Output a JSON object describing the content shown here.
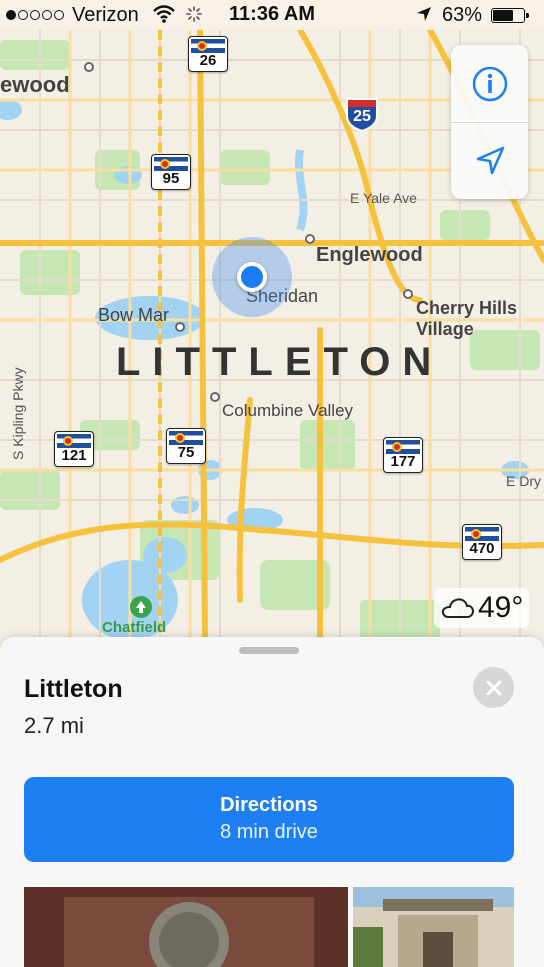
{
  "status_bar": {
    "carrier": "Verizon",
    "signal_bars": 1,
    "time": "11:36 AM",
    "battery_percent": "63%",
    "battery_level": 0.63
  },
  "map": {
    "labels": {
      "englewood_west": "ewood",
      "englewood": "Englewood",
      "sheridan": "Sheridan",
      "cherry_hills_line1": "Cherry Hills",
      "cherry_hills_line2": "Village",
      "bow_mar": "Bow Mar",
      "littleton": "LITTLETON",
      "columbine_valley": "Columbine Valley",
      "e_yale_ave": "E Yale Ave",
      "s_kipling_pkwy": "S Kipling Pkwy",
      "e_dry": "E Dry",
      "chatfield": "Chatfield"
    },
    "shields": {
      "r26": "26",
      "r95": "95",
      "r121": "121",
      "r75": "75",
      "r177": "177",
      "r470": "470",
      "i25": "25"
    },
    "weather": {
      "temperature": "49°",
      "icon": "cloud-icon"
    },
    "controls": {
      "info_icon": "info-icon",
      "tracking_icon": "location-arrow-icon"
    }
  },
  "place_card": {
    "title": "Littleton",
    "distance": "2.7 mi",
    "directions_label": "Directions",
    "directions_eta": "8 min drive"
  },
  "colors": {
    "accent": "#1e7ff4",
    "user_location": "#1d7cf2",
    "highway": "#f6c23e",
    "park": "#b9e0a5",
    "water": "#9fcff2"
  }
}
